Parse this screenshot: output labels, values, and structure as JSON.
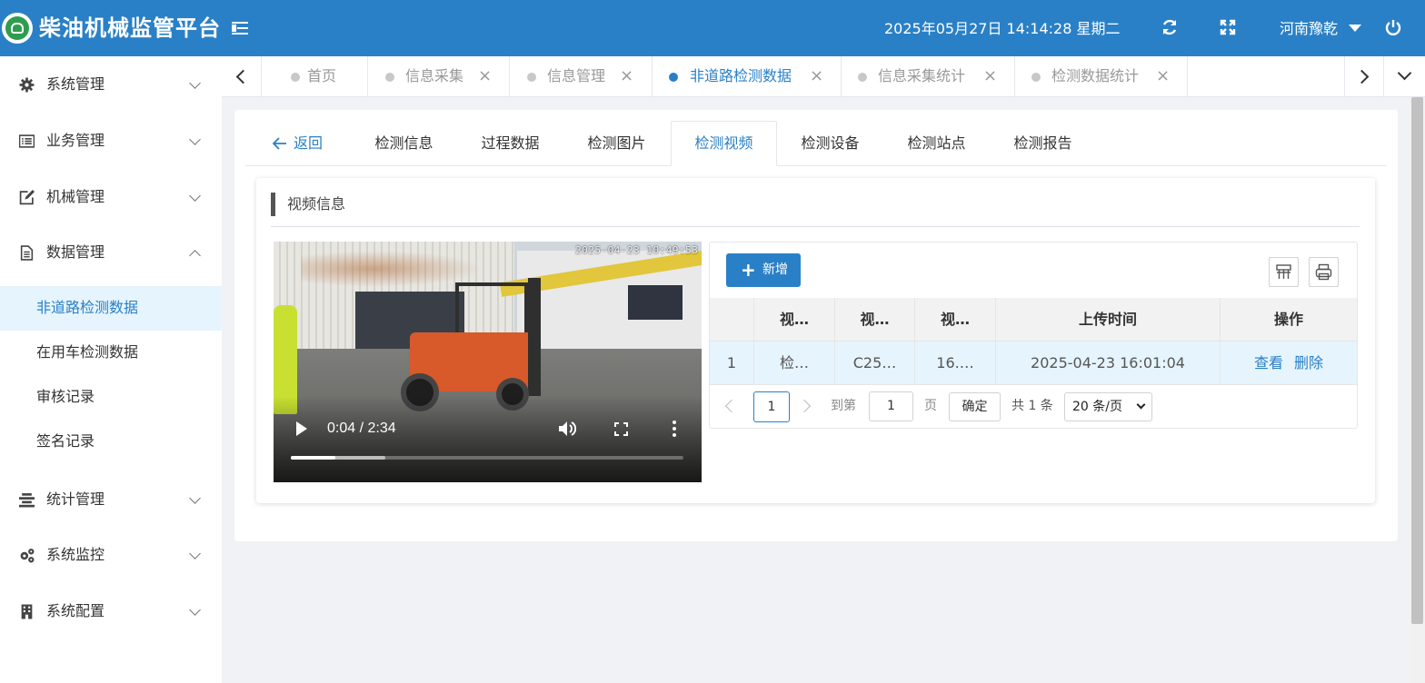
{
  "header": {
    "app_title": "柴油机械监管平台",
    "datetime": "2025年05月27日 14:14:28 星期二",
    "user": "河南豫乾",
    "accent": "#2a80c6"
  },
  "sidebar": {
    "items": [
      {
        "label": "系统管理",
        "icon": "gear-icon"
      },
      {
        "label": "业务管理",
        "icon": "list-icon"
      },
      {
        "label": "机械管理",
        "icon": "edit-icon"
      },
      {
        "label": "数据管理",
        "icon": "document-icon"
      },
      {
        "label": "统计管理",
        "icon": "align-icon"
      },
      {
        "label": "系统监控",
        "icon": "gears-icon"
      },
      {
        "label": "系统配置",
        "icon": "building-icon"
      }
    ],
    "sub_items": [
      "非道路检测数据",
      "在用车检测数据",
      "审核记录",
      "签名记录"
    ]
  },
  "tabs": [
    {
      "label": "首页",
      "closable": false
    },
    {
      "label": "信息采集",
      "closable": true
    },
    {
      "label": "信息管理",
      "closable": true
    },
    {
      "label": "非道路检测数据",
      "closable": true,
      "active": true
    },
    {
      "label": "信息采集统计",
      "closable": true
    },
    {
      "label": "检测数据统计",
      "closable": true
    }
  ],
  "subtabs": {
    "back": "返回",
    "items": [
      "检测信息",
      "过程数据",
      "检测图片",
      "检测视频",
      "检测设备",
      "检测站点",
      "检测报告"
    ],
    "active": "检测视频"
  },
  "section": {
    "title": "视频信息"
  },
  "video": {
    "timestamp": "2025-04-23 10:49:53",
    "time": "0:04 / 2:34",
    "played_fraction": 0.026,
    "buffered_fraction": 0.24
  },
  "table": {
    "add_label": "新增",
    "columns": [
      "",
      "视…",
      "视…",
      "视…",
      "上传时间",
      "操作"
    ],
    "rows": [
      {
        "index": "1",
        "c1": "检…",
        "c2": "C25…",
        "c3": "16.…",
        "upload_time": "2025-04-23 16:01:04",
        "view": "查看",
        "delete": "删除"
      }
    ]
  },
  "pager": {
    "current": "1",
    "goto_label": "到第",
    "goto_value": "1",
    "page_label": "页",
    "confirm": "确定",
    "total": "共 1 条",
    "page_size": "20 条/页"
  }
}
